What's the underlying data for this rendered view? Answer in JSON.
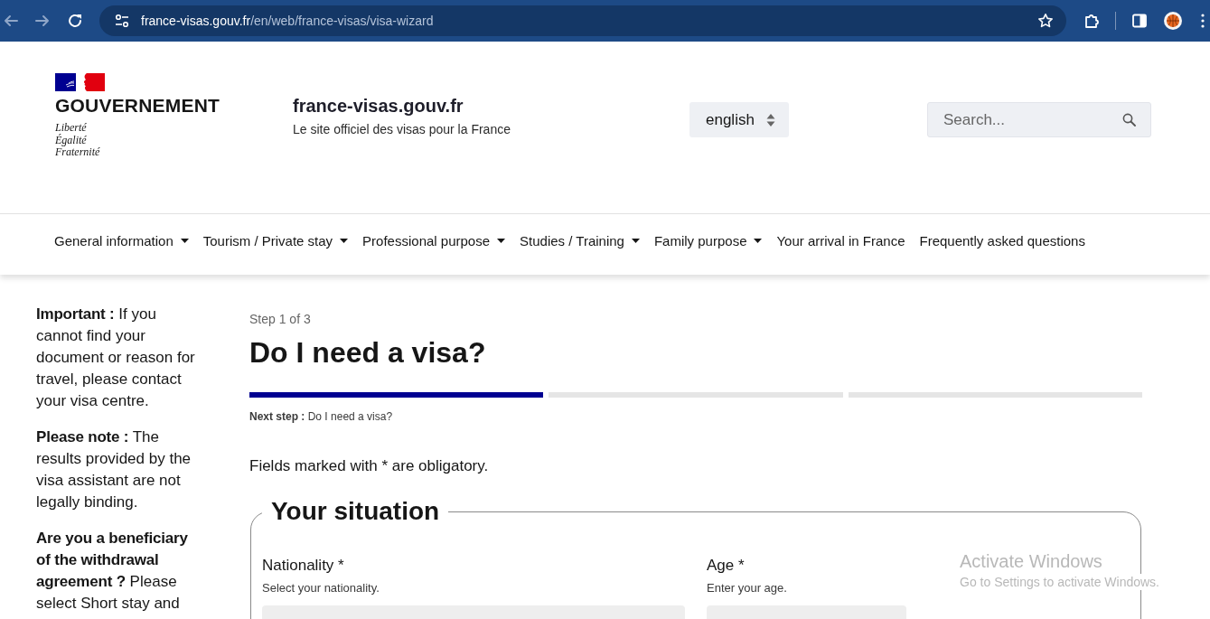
{
  "browser": {
    "back_enabled": false,
    "forward_enabled": false,
    "url": {
      "host": "france-visas.gouv.fr",
      "path": "/en/web/france-visas/visa-wizard"
    }
  },
  "header": {
    "logo": {
      "name": "GOUVERNEMENT",
      "motto": [
        "Liberté",
        "Égalité",
        "Fraternité"
      ]
    },
    "site": {
      "title": "france-visas.gouv.fr",
      "subtitle": "Le site officiel des visas pour la France"
    },
    "language": {
      "value": "english"
    },
    "search": {
      "placeholder": "Search..."
    }
  },
  "nav": [
    {
      "label": "General information",
      "dropdown": true
    },
    {
      "label": "Tourism / Private stay",
      "dropdown": true
    },
    {
      "label": "Professional purpose",
      "dropdown": true
    },
    {
      "label": "Studies / Training",
      "dropdown": true
    },
    {
      "label": "Family purpose",
      "dropdown": true
    },
    {
      "label": "Your arrival in France",
      "dropdown": false
    },
    {
      "label": "Frequently asked questions",
      "dropdown": false
    }
  ],
  "sidebar": {
    "notes": [
      "**Important :** If you cannot find your document or reason for travel, please contact your visa centre.",
      "**Please note :** The results provided by the visa assistant are not legally binding.",
      "**Are you a beneficiary of the withdrawal agreement ?** Please select Short stay and"
    ]
  },
  "wizard": {
    "step_label": "Step 1 of 3",
    "title": "Do I need a visa?",
    "progress": [
      {
        "active": true
      },
      {
        "active": false
      },
      {
        "active": false
      }
    ],
    "next_step": "**Next step :** Do I need a visa?",
    "required_note": "Fields marked with * are obligatory.",
    "section": {
      "title": "Your situation",
      "fields": [
        {
          "label": "Nationality *",
          "hint": "Select your nationality."
        },
        {
          "label": "Age *",
          "hint": "Enter your age."
        }
      ]
    }
  },
  "os_notice": {
    "title": "Activate Windows",
    "text": "Go to Settings to activate Windows."
  }
}
